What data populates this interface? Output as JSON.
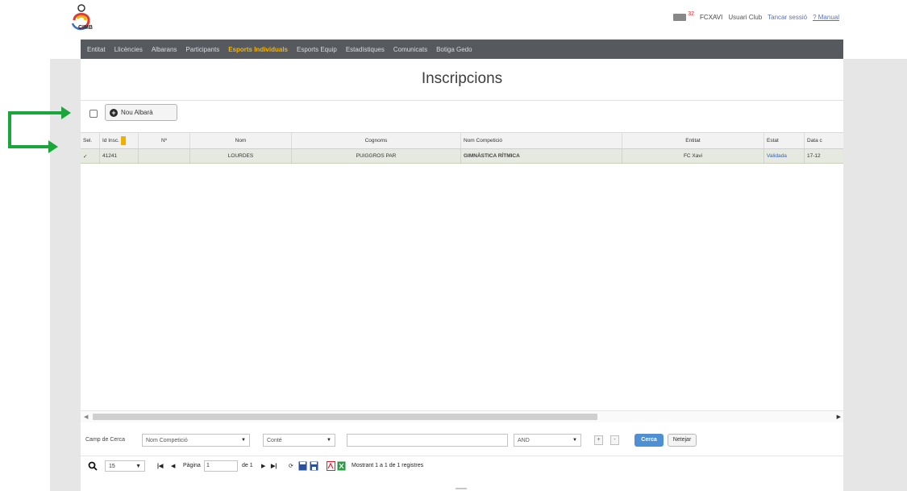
{
  "header": {
    "logo_text": "CIMB",
    "mail_count": "32",
    "user_code": "FCXAVI",
    "user_type": "Usuari Club",
    "logout": "Tancar sessió",
    "manual": "? Manual"
  },
  "nav": [
    {
      "label": "Entitat",
      "active": false
    },
    {
      "label": "Llicències",
      "active": false
    },
    {
      "label": "Albarans",
      "active": false
    },
    {
      "label": "Participants",
      "active": false
    },
    {
      "label": "Esports Individuals",
      "active": true
    },
    {
      "label": "Esports Equip",
      "active": false
    },
    {
      "label": "Estadístiques",
      "active": false
    },
    {
      "label": "Comunicats",
      "active": false
    },
    {
      "label": "Botiga Gedo",
      "active": false
    }
  ],
  "page": {
    "title": "Inscripcions",
    "new_button": "Nou Albarà"
  },
  "grid": {
    "columns": [
      "Sel.",
      "Id Insc.",
      "Nº",
      "Nom",
      "Cognoms",
      "Nom Competició",
      "Entitat",
      "Estat",
      "Data c"
    ],
    "rows": [
      [
        "✓",
        "41241",
        "",
        "LOURDES",
        "PUIGGROS PAR",
        "GIMNÀSTICA RÍTMICA",
        "FC Xavi",
        "Validada",
        "17-12"
      ]
    ]
  },
  "search": {
    "label": "Camp de Cerca",
    "field": "Nom Competició",
    "operator": "Conté",
    "value": "",
    "logic": "AND",
    "plus": "+",
    "minus": "-",
    "search_button": "Cerca",
    "clear_button": "Netejar"
  },
  "pager": {
    "page_size": "15",
    "page_label": "Pàgina",
    "page_value": "1",
    "of_label": "de 1",
    "status": "Mostrant 1 a 1 de 1 registres"
  },
  "annotation_color": "#1aa63a"
}
